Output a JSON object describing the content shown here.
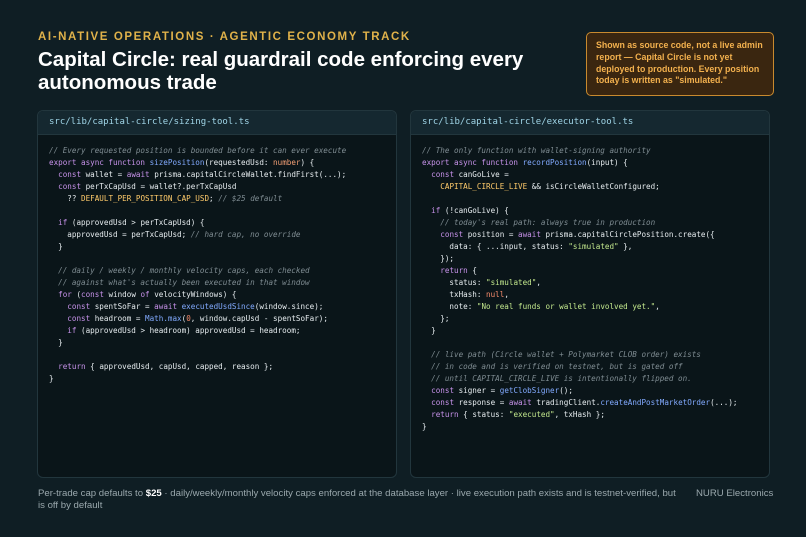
{
  "header": {
    "kicker": "AI-NATIVE OPERATIONS · AGENTIC ECONOMY TRACK",
    "title": "Capital Circle: real guardrail code enforcing every autonomous trade"
  },
  "notice": {
    "text": "Shown as source code, not a live admin report — Capital Circle is not yet deployed to production. Every position today is written as \"simulated.\""
  },
  "panels": {
    "left": {
      "filename": "src/lib/capital-circle/sizing-tool.ts",
      "lines": [
        [
          [
            "cm",
            "// Every requested position is bounded before it can ever execute"
          ]
        ],
        [
          [
            "kw",
            "export async function "
          ],
          [
            "fn",
            "sizePosition"
          ],
          [
            "pl",
            "(requestedUsd: "
          ],
          [
            "ty",
            "number"
          ],
          [
            "pl",
            ") {"
          ]
        ],
        [
          [
            "pl",
            "  "
          ],
          [
            "kw",
            "const "
          ],
          [
            "pl",
            "wallet = "
          ],
          [
            "kw",
            "await "
          ],
          [
            "pl",
            "prisma.capitalCircleWallet.findFirst(...);"
          ]
        ],
        [
          [
            "pl",
            "  "
          ],
          [
            "kw",
            "const "
          ],
          [
            "pl",
            "perTxCapUsd = wallet?.perTxCapUsd"
          ]
        ],
        [
          [
            "pl",
            "    ?? "
          ],
          [
            "co",
            "DEFAULT_PER_POSITION_CAP_USD"
          ],
          [
            "pl",
            "; "
          ],
          [
            "cm",
            "// $25 default"
          ]
        ],
        [
          [
            "pl",
            ""
          ]
        ],
        [
          [
            "pl",
            "  "
          ],
          [
            "kw",
            "if "
          ],
          [
            "pl",
            "(approvedUsd > perTxCapUsd) {"
          ]
        ],
        [
          [
            "pl",
            "    approvedUsd = perTxCapUsd; "
          ],
          [
            "cm",
            "// hard cap, no override"
          ]
        ],
        [
          [
            "pl",
            "  }"
          ]
        ],
        [
          [
            "pl",
            ""
          ]
        ],
        [
          [
            "cm",
            "  // daily / weekly / monthly velocity caps, each checked"
          ]
        ],
        [
          [
            "cm",
            "  // against what's actually been executed in that window"
          ]
        ],
        [
          [
            "pl",
            "  "
          ],
          [
            "kw",
            "for "
          ],
          [
            "pl",
            "("
          ],
          [
            "kw",
            "const "
          ],
          [
            "pl",
            "window "
          ],
          [
            "kw",
            "of "
          ],
          [
            "pl",
            "velocityWindows) {"
          ]
        ],
        [
          [
            "pl",
            "    "
          ],
          [
            "kw",
            "const "
          ],
          [
            "pl",
            "spentSoFar = "
          ],
          [
            "kw",
            "await "
          ],
          [
            "fn",
            "executedUsdSince"
          ],
          [
            "pl",
            "(window.since);"
          ]
        ],
        [
          [
            "pl",
            "    "
          ],
          [
            "kw",
            "const "
          ],
          [
            "pl",
            "headroom = "
          ],
          [
            "fn",
            "Math.max"
          ],
          [
            "pl",
            "("
          ],
          [
            "nu",
            "0"
          ],
          [
            "pl",
            ", window.capUsd - spentSoFar);"
          ]
        ],
        [
          [
            "pl",
            "    "
          ],
          [
            "kw",
            "if "
          ],
          [
            "pl",
            "(approvedUsd > headroom) approvedUsd = headroom;"
          ]
        ],
        [
          [
            "pl",
            "  }"
          ]
        ],
        [
          [
            "pl",
            ""
          ]
        ],
        [
          [
            "pl",
            "  "
          ],
          [
            "kw",
            "return "
          ],
          [
            "pl",
            "{ approvedUsd, capUsd, capped, reason };"
          ]
        ],
        [
          [
            "pl",
            "}"
          ]
        ]
      ]
    },
    "right": {
      "filename": "src/lib/capital-circle/executor-tool.ts",
      "lines": [
        [
          [
            "cm",
            "// The only function with wallet-signing authority"
          ]
        ],
        [
          [
            "kw",
            "export async function "
          ],
          [
            "fn",
            "recordPosition"
          ],
          [
            "pl",
            "(input) {"
          ]
        ],
        [
          [
            "pl",
            "  "
          ],
          [
            "kw",
            "const "
          ],
          [
            "pl",
            "canGoLive ="
          ]
        ],
        [
          [
            "pl",
            "    "
          ],
          [
            "co",
            "CAPITAL_CIRCLE_LIVE"
          ],
          [
            "pl",
            " && isCircleWalletConfigured;"
          ]
        ],
        [
          [
            "pl",
            ""
          ]
        ],
        [
          [
            "pl",
            "  "
          ],
          [
            "kw",
            "if "
          ],
          [
            "pl",
            "(!canGoLive) {"
          ]
        ],
        [
          [
            "cm",
            "    // today's real path: always true in production"
          ]
        ],
        [
          [
            "pl",
            "    "
          ],
          [
            "kw",
            "const "
          ],
          [
            "pl",
            "position = "
          ],
          [
            "kw",
            "await "
          ],
          [
            "pl",
            "prisma.capitalCirclePosition.create({"
          ]
        ],
        [
          [
            "pl",
            "      data: { ...input, status: "
          ],
          [
            "st",
            "\"simulated\""
          ],
          [
            "pl",
            " },"
          ]
        ],
        [
          [
            "pl",
            "    });"
          ]
        ],
        [
          [
            "pl",
            "    "
          ],
          [
            "kw",
            "return "
          ],
          [
            "pl",
            "{"
          ]
        ],
        [
          [
            "pl",
            "      status: "
          ],
          [
            "st",
            "\"simulated\""
          ],
          [
            "pl",
            ","
          ]
        ],
        [
          [
            "pl",
            "      txHash: "
          ],
          [
            "nu",
            "null"
          ],
          [
            "pl",
            ","
          ]
        ],
        [
          [
            "pl",
            "      note: "
          ],
          [
            "st",
            "\"No real funds or wallet involved yet.\""
          ],
          [
            "pl",
            ","
          ]
        ],
        [
          [
            "pl",
            "    };"
          ]
        ],
        [
          [
            "pl",
            "  }"
          ]
        ],
        [
          [
            "pl",
            ""
          ]
        ],
        [
          [
            "cm",
            "  // live path (Circle wallet + Polymarket CLOB order) exists"
          ]
        ],
        [
          [
            "cm",
            "  // in code and is verified on testnet, but is gated off"
          ]
        ],
        [
          [
            "cm",
            "  // until CAPITAL_CIRCLE_LIVE is intentionally flipped on."
          ]
        ],
        [
          [
            "pl",
            "  "
          ],
          [
            "kw",
            "const "
          ],
          [
            "pl",
            "signer = "
          ],
          [
            "fn",
            "getClobSigner"
          ],
          [
            "pl",
            "();"
          ]
        ],
        [
          [
            "pl",
            "  "
          ],
          [
            "kw",
            "const "
          ],
          [
            "pl",
            "response = "
          ],
          [
            "kw",
            "await "
          ],
          [
            "pl",
            "tradingClient."
          ],
          [
            "fn",
            "createAndPostMarketOrder"
          ],
          [
            "pl",
            "(...);"
          ]
        ],
        [
          [
            "pl",
            "  "
          ],
          [
            "kw",
            "return "
          ],
          [
            "pl",
            "{ status: "
          ],
          [
            "st",
            "\"executed\""
          ],
          [
            "pl",
            ", txHash };"
          ]
        ],
        [
          [
            "pl",
            "}"
          ]
        ]
      ]
    }
  },
  "footer": {
    "prefix": "Per-trade cap defaults to ",
    "cap": "$25",
    "suffix": " · daily/weekly/monthly velocity caps enforced at the database layer · live execution path exists and is testnet-verified, but is off by default",
    "brand": "NURU Electronics"
  }
}
